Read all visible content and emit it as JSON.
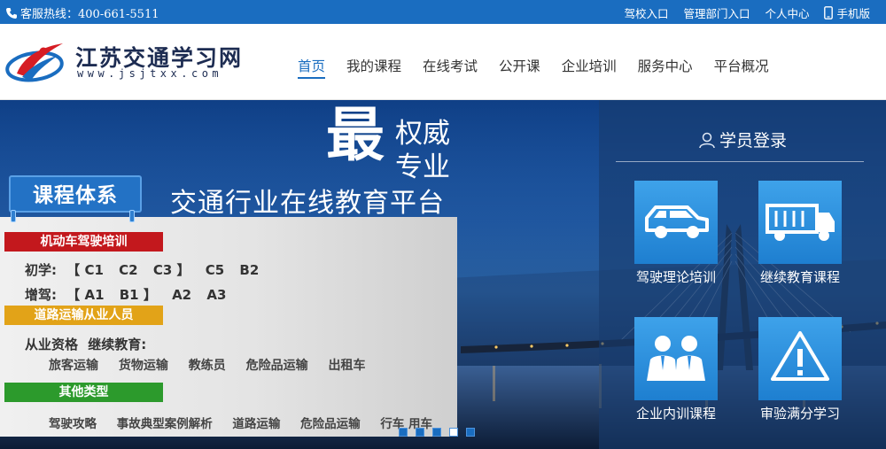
{
  "topbar": {
    "hotline": "客服热线：400-661-5511",
    "links": [
      "驾校入口",
      "管理部门入口",
      "个人中心"
    ],
    "mobile": "手机版"
  },
  "logo": {
    "title": "江苏交通学习网",
    "subtitle": "www.jsjtxx.com"
  },
  "nav": {
    "items": [
      "首页",
      "我的课程",
      "在线考试",
      "公开课",
      "企业培训",
      "服务中心",
      "平台概况"
    ],
    "active": "首页"
  },
  "banner": {
    "big": "最",
    "line1": "权威",
    "line2": "专业",
    "line3": "交通行业在线教育平台"
  },
  "course": {
    "tag": "课程体系",
    "sections": [
      {
        "title": "机动车驾驶培训",
        "lines": [
          {
            "label": "初学:",
            "items": [
              "【 C1",
              "C2",
              "C3 】",
              "C5",
              "B2"
            ]
          },
          {
            "label": "增驾:",
            "items": [
              "【 A1",
              "B1 】",
              "A2",
              "A3"
            ]
          }
        ]
      },
      {
        "title": "道路运输从业人员",
        "lines": [
          {
            "label": "从业资格",
            "items": [
              "继续教育:"
            ]
          }
        ],
        "items": [
          "旅客运输",
          "货物运输",
          "教练员",
          "危险品运输",
          "出租车"
        ]
      },
      {
        "title": "其他类型",
        "items": [
          "驾驶攻略",
          "事故典型案例解析",
          "道路运输",
          "危险品运输",
          "行车 用车"
        ]
      }
    ]
  },
  "carousel": {
    "count": 5,
    "active": 3
  },
  "login": {
    "title": "学员登录",
    "tiles": [
      {
        "label": "驾驶理论培训",
        "icon": "car-icon"
      },
      {
        "label": "继续教育课程",
        "icon": "truck-icon"
      },
      {
        "label": "企业内训课程",
        "icon": "people-icon"
      },
      {
        "label": "审验满分学习",
        "icon": "warning-icon"
      }
    ]
  },
  "colors": {
    "brand": "#1a6dc0",
    "red": "#c3181d",
    "yellow": "#e2a318",
    "green": "#2c9a2c"
  }
}
